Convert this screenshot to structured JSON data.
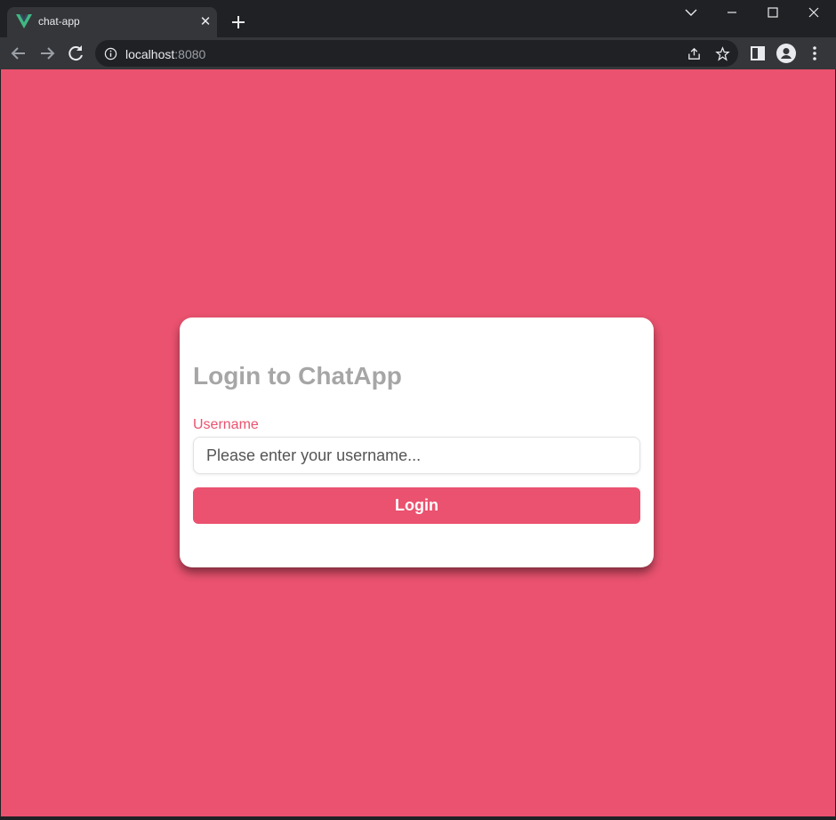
{
  "browser": {
    "tab_title": "chat-app",
    "url_host": "localhost",
    "url_port": ":8080"
  },
  "login": {
    "title": "Login to ChatApp",
    "username_label": "Username",
    "username_placeholder": "Please enter your username...",
    "username_value": "",
    "button_label": "Login"
  },
  "colors": {
    "accent": "#ea526f",
    "title": "#a6a6a6",
    "card": "#ffffff"
  }
}
